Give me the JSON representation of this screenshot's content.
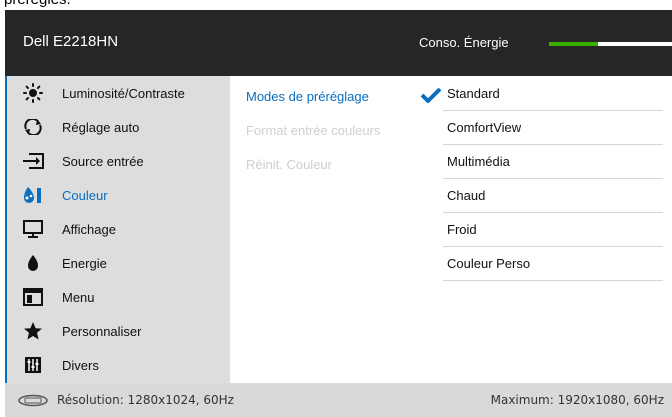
{
  "top_text": "préréglés.",
  "header": {
    "model": "Dell E2218HN",
    "energy_label": "Conso. Énergie",
    "energy_level": 0.4
  },
  "sidebar": {
    "items": [
      {
        "label": "Luminosité/Contraste",
        "icon": "sun-icon"
      },
      {
        "label": "Réglage auto",
        "icon": "auto-adjust-icon"
      },
      {
        "label": "Source entrée",
        "icon": "input-source-icon"
      },
      {
        "label": "Couleur",
        "icon": "color-icon",
        "active": true
      },
      {
        "label": "Affichage",
        "icon": "display-icon"
      },
      {
        "label": "Energie",
        "icon": "energy-icon"
      },
      {
        "label": "Menu",
        "icon": "menu-icon"
      },
      {
        "label": "Personnaliser",
        "icon": "star-icon"
      },
      {
        "label": "Divers",
        "icon": "others-icon"
      }
    ]
  },
  "submenu": {
    "items": [
      {
        "label": "Modes de préréglage",
        "state": "active"
      },
      {
        "label": "Format entrée couleurs",
        "state": "disabled"
      },
      {
        "label": "Réinit. Couleur",
        "state": "disabled"
      }
    ]
  },
  "options": {
    "selected": "Standard",
    "items": [
      "Standard",
      "ComfortView",
      "Multimédia",
      "Chaud",
      "Froid",
      "Couleur Perso"
    ]
  },
  "footer": {
    "resolution": "Résolution: 1280x1024, 60Hz",
    "maximum": "Maximum: 1920x1080, 60Hz"
  },
  "colors": {
    "accent": "#0a6fbf",
    "energy": "#38b000"
  }
}
